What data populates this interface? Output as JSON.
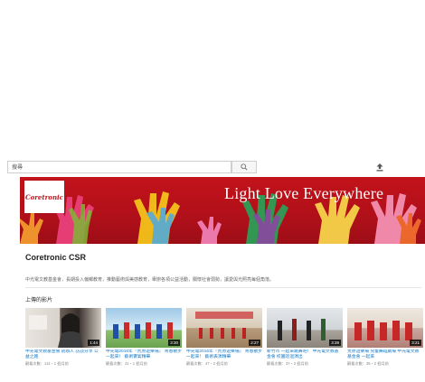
{
  "search": {
    "placeholder": "搜尋"
  },
  "icons": {
    "search": "search-icon",
    "upload": "upload-icon"
  },
  "colors": {
    "banner_red": "#c3121a",
    "link_blue": "#167ac6"
  },
  "channel": {
    "logo_text": "Coretronic",
    "banner_slogan": "Light Love Everywhere",
    "name": "Coretronic CSR",
    "description": "中光電文教基金會，長期投入偏鄉教育，推動藝術與美感教育，舉辦各項公益活動，關懷社會弱勢，讓愛與光照亮每個角落。"
  },
  "section": {
    "title": "上傳的影片"
  },
  "videos": [
    {
      "title": "中光電文教基金會 創辦人 訪談分享 公益之路",
      "duration": "1:44",
      "meta": "觀看次數：114・1 個月前"
    },
    {
      "title": "中光電2016年『荒原遊樂場』 青春散步一起來！ 藝術饗宴精華",
      "duration": "3:30",
      "meta": "觀看次數：41・1 個月前"
    },
    {
      "title": "中光電2016年『荒原遊樂場』 青春散步一起來！ 藝術表演精華",
      "duration": "2:27",
      "meta": "觀看次數：47・2 個月前"
    },
    {
      "title": "新竹市 一起來跳舞吧！ 中光電文教基金會 校園巡迴演出",
      "duration": "3:39",
      "meta": "觀看次數：37・2 個月前"
    },
    {
      "title": "荒原遊樂場 兒童舞蹈劇場 中光電文教基金會 一起來",
      "duration": "3:21",
      "meta": "觀看次數：35・2 個月前"
    }
  ]
}
